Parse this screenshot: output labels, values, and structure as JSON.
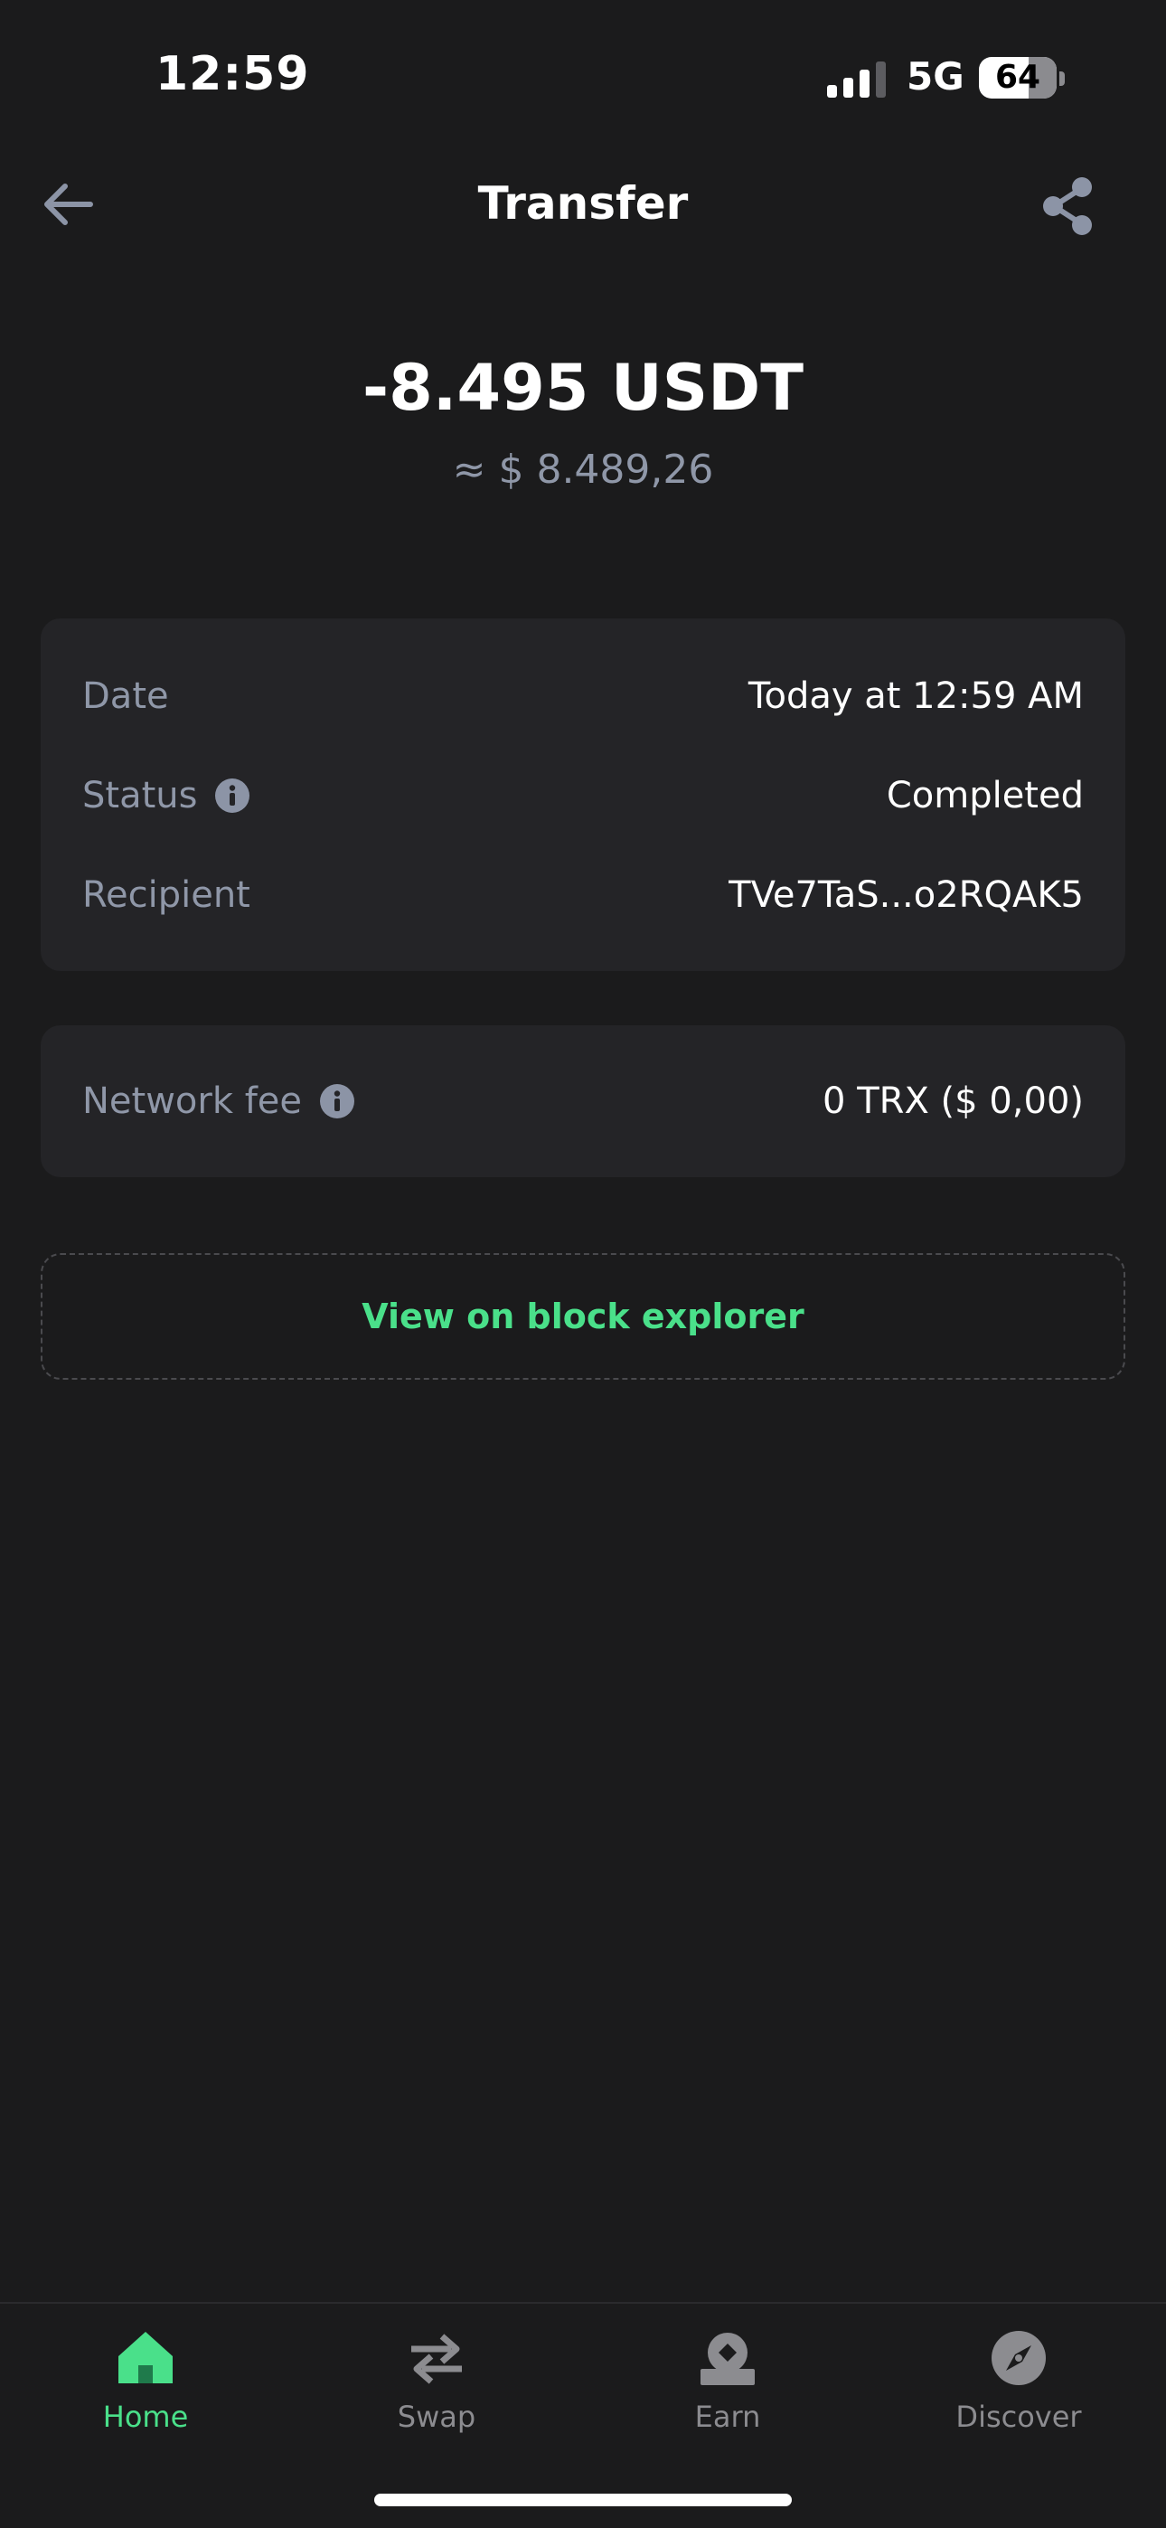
{
  "status_bar": {
    "time": "12:59",
    "network": "5G",
    "battery": "64",
    "battery_level": 0.64
  },
  "header": {
    "title": "Transfer",
    "back_icon": "arrow-left-icon",
    "share_icon": "share-icon"
  },
  "transaction": {
    "amount": "-8.495 USDT",
    "fiat_amount": "≈ $ 8.489,26"
  },
  "details": {
    "date_label": "Date",
    "date_value": "Today at 12:59 AM",
    "status_label": "Status",
    "status_value": "Completed",
    "recipient_label": "Recipient",
    "recipient_value": "TVe7TaS...o2RQAK5"
  },
  "fee": {
    "label": "Network fee",
    "value": "0 TRX ($ 0,00)"
  },
  "explorer": {
    "label": "View on block explorer"
  },
  "tabs": [
    {
      "label": "Home",
      "icon": "home-icon",
      "active": true
    },
    {
      "label": "Swap",
      "icon": "swap-icon",
      "active": false
    },
    {
      "label": "Earn",
      "icon": "earn-icon",
      "active": false
    },
    {
      "label": "Discover",
      "icon": "compass-icon",
      "active": false
    }
  ],
  "colors": {
    "background": "#1b1b1c",
    "card": "#242427",
    "accent": "#4ae08a",
    "muted_text": "#8f97a8"
  }
}
